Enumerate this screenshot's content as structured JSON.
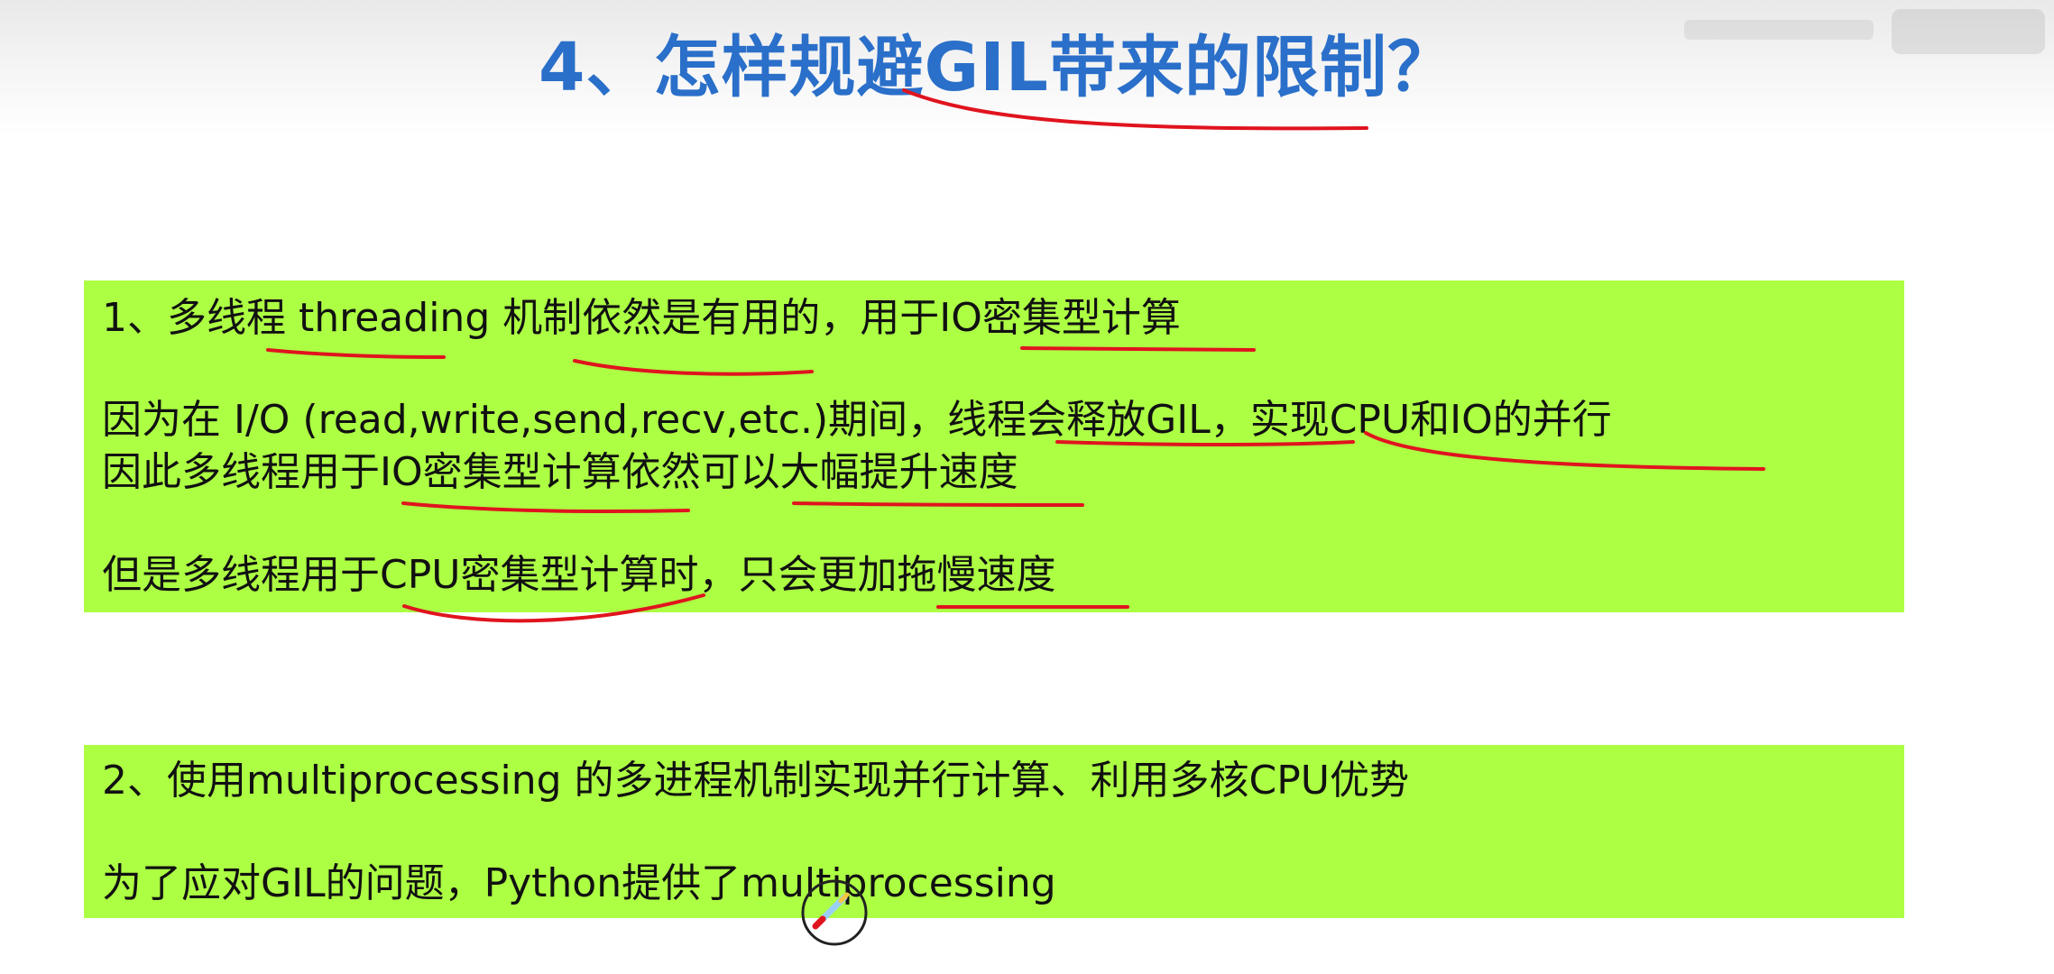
{
  "slide": {
    "title": "4、怎样规避GIL带来的限制？",
    "section1": {
      "heading": "1、多线程 threading 机制依然是有用的，用于IO密集型计算",
      "line2": "因为在 I/O (read,write,send,recv,etc.)期间，线程会释放GIL，实现CPU和IO的并行",
      "line3": "因此多线程用于IO密集型计算依然可以大幅提升速度",
      "line4": "但是多线程用于CPU密集型计算时，只会更加拖慢速度"
    },
    "section2": {
      "heading": "2、使用multiprocessing 的多进程机制实现并行计算、利用多核CPU优势",
      "line2": "为了应对GIL的问题，Python提供了multiprocessing"
    }
  },
  "colors": {
    "title": "#2a6fc9",
    "box_background": "#adff44",
    "annotation_pen": "#e0141e",
    "text": "#111111"
  },
  "icons": {
    "pen_cursor": "pen-cursor-icon",
    "watermark": "bilibili-watermark-icon"
  }
}
